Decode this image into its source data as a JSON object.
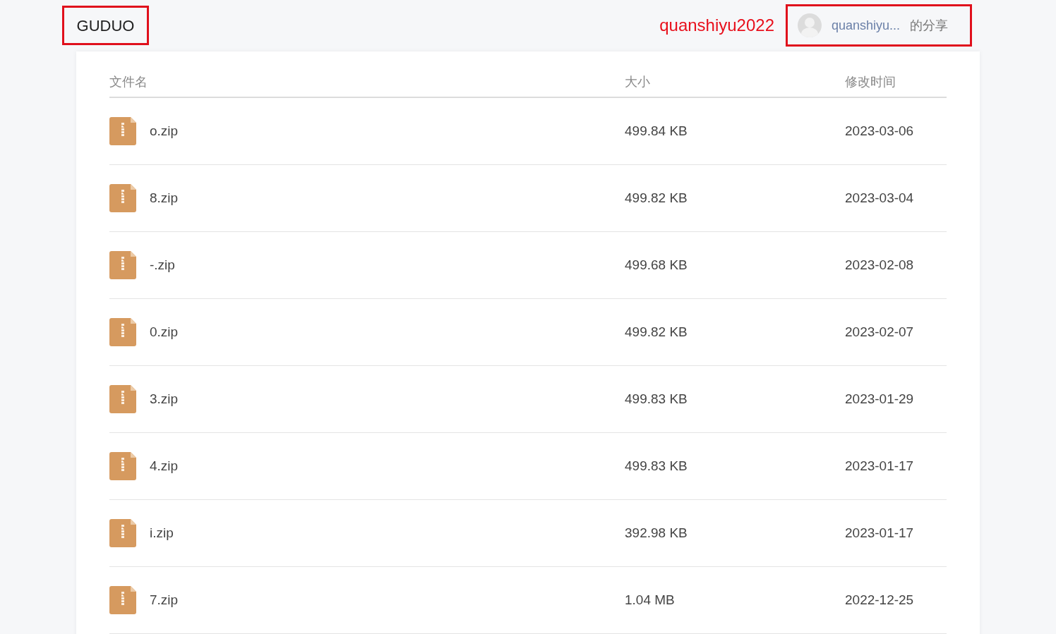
{
  "header": {
    "logo": "GUDUO",
    "annotation": "quanshiyu2022",
    "user": {
      "name": "quanshiyu...",
      "suffix": "的分享"
    }
  },
  "table": {
    "columns": [
      "文件名",
      "大小",
      "修改时间"
    ],
    "rows": [
      {
        "name": "o.zip",
        "size": "499.84 KB",
        "modified": "2023-03-06"
      },
      {
        "name": "8.zip",
        "size": "499.82 KB",
        "modified": "2023-03-04"
      },
      {
        "name": "-.zip",
        "size": "499.68 KB",
        "modified": "2023-02-08"
      },
      {
        "name": "0.zip",
        "size": "499.82 KB",
        "modified": "2023-02-07"
      },
      {
        "name": "3.zip",
        "size": "499.83 KB",
        "modified": "2023-01-29"
      },
      {
        "name": "4.zip",
        "size": "499.83 KB",
        "modified": "2023-01-17"
      },
      {
        "name": "i.zip",
        "size": "392.98 KB",
        "modified": "2023-01-17"
      },
      {
        "name": "7.zip",
        "size": "1.04 MB",
        "modified": "2022-12-25"
      }
    ]
  }
}
